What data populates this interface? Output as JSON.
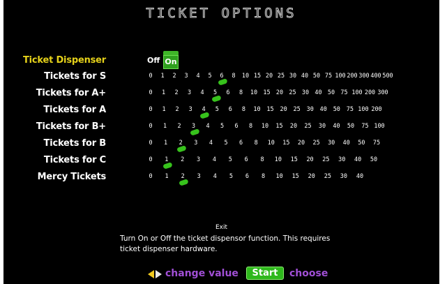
{
  "title": "TICKET OPTIONS",
  "dispenser": {
    "label": "Ticket Dispenser",
    "off_label": "Off",
    "on_label": "On",
    "selected": "On",
    "label_color": "#e6d21a",
    "on_color": "#2fa11e"
  },
  "rows": [
    {
      "label": "Tickets for S",
      "values": [
        "0",
        "1",
        "2",
        "3",
        "4",
        "5",
        "6",
        "8",
        "10",
        "15",
        "20",
        "25",
        "30",
        "40",
        "50",
        "75",
        "100",
        "200",
        "300",
        "400",
        "500"
      ],
      "selected_index": 6
    },
    {
      "label": "Tickets for A+",
      "values": [
        "0",
        "1",
        "2",
        "3",
        "4",
        "5",
        "6",
        "8",
        "10",
        "15",
        "20",
        "25",
        "30",
        "40",
        "50",
        "75",
        "100",
        "200",
        "300"
      ],
      "selected_index": 5
    },
    {
      "label": "Tickets for A",
      "values": [
        "0",
        "1",
        "2",
        "3",
        "4",
        "5",
        "6",
        "8",
        "10",
        "15",
        "20",
        "25",
        "30",
        "40",
        "50",
        "75",
        "100",
        "200"
      ],
      "selected_index": 4
    },
    {
      "label": "Tickets for B+",
      "values": [
        "0",
        "1",
        "2",
        "3",
        "4",
        "5",
        "6",
        "8",
        "10",
        "15",
        "20",
        "25",
        "30",
        "40",
        "50",
        "75",
        "100"
      ],
      "selected_index": 3
    },
    {
      "label": "Tickets for B",
      "values": [
        "0",
        "1",
        "2",
        "3",
        "4",
        "5",
        "6",
        "8",
        "10",
        "15",
        "20",
        "25",
        "30",
        "40",
        "50",
        "75"
      ],
      "selected_index": 2
    },
    {
      "label": "Tickets for C",
      "values": [
        "0",
        "1",
        "2",
        "3",
        "4",
        "5",
        "6",
        "8",
        "10",
        "15",
        "20",
        "25",
        "30",
        "40",
        "50"
      ],
      "selected_index": 1
    },
    {
      "label": "Mercy Tickets",
      "values": [
        "0",
        "1",
        "2",
        "3",
        "4",
        "5",
        "6",
        "8",
        "10",
        "15",
        "20",
        "25",
        "30",
        "40"
      ],
      "selected_index": 2
    }
  ],
  "marker_color": "#37c21c",
  "exit_label": "Exit",
  "help_text": "Turn On or Off the ticket dispensor function. This requires ticket dispenser hardware.",
  "legend": {
    "arrows_icon": "left-right-arrows-icon",
    "change_label": "change value",
    "start_label": "Start",
    "choose_label": "choose",
    "legend_color": "#a14fd6"
  }
}
